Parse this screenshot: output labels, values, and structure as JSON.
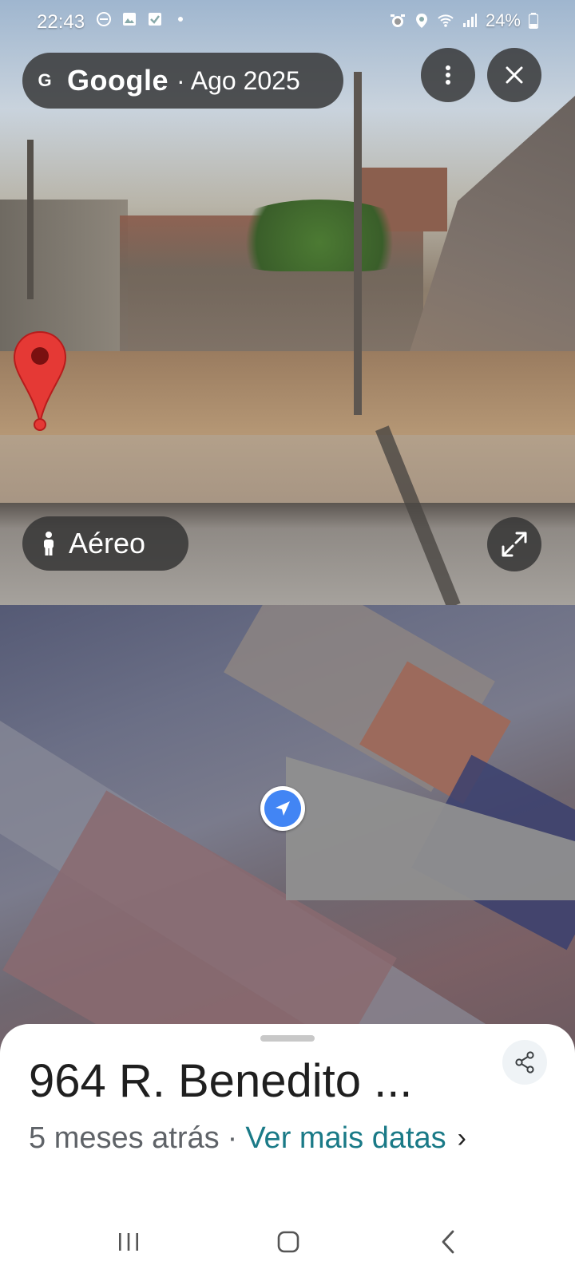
{
  "status_bar": {
    "time": "22:43",
    "battery": "24%",
    "icons_left": [
      "dnd-icon",
      "gallery-icon",
      "check-icon",
      "dot-icon"
    ],
    "icons_right": [
      "alarm-icon",
      "location-icon",
      "wifi-icon",
      "signal-icon",
      "battery-icon"
    ]
  },
  "street_view": {
    "brand": "Google",
    "date": "· Ago 2025",
    "mode_label": "Aéreo"
  },
  "place": {
    "title": "964 R. Benedito ...",
    "age": "5 meses atrás",
    "separator": "·",
    "more_dates": "Ver mais datas",
    "chevron": "›"
  },
  "colors": {
    "chip_bg": "#323232",
    "pin_red": "#e53935",
    "nav_dot_blue": "#4285f4",
    "link_teal": "#1a7a87"
  }
}
